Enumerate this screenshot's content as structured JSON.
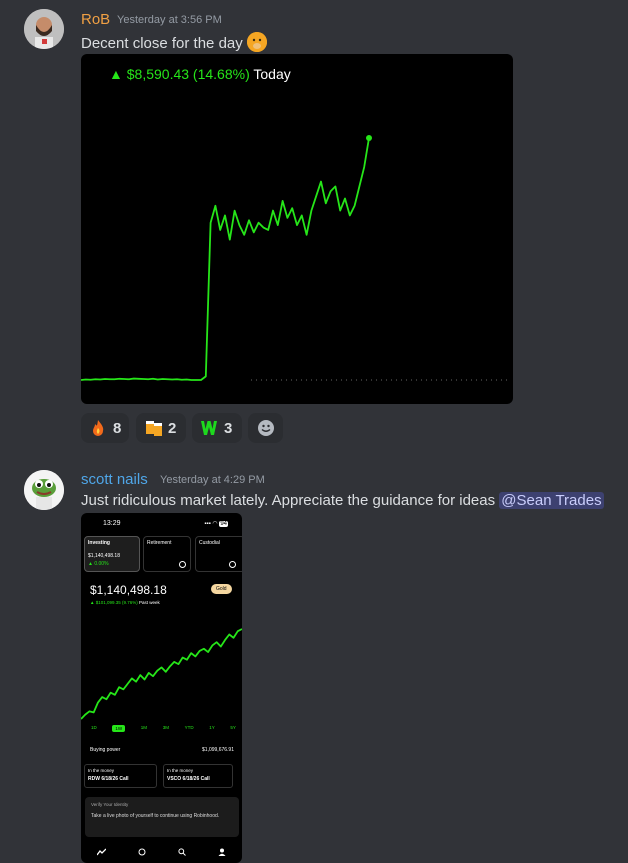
{
  "messages": [
    {
      "username": "RoB",
      "username_color": "#f0a044",
      "timestamp": "Yesterday at 3:56 PM",
      "text": "Decent close for the day",
      "emoji": "face-with-hand-over-mouth",
      "attachment": {
        "gain_text": "▲ $8,590.43 (14.68%)",
        "period": "Today",
        "chart_data": {
          "type": "line",
          "color": "#26e619",
          "series": [
            {
              "values": [
                0.0,
                0.2,
                0.1,
                0.3,
                0.2,
                0.4,
                0.3,
                0.3,
                0.5,
                0.4,
                0.3,
                0.6,
                0.5,
                0.4,
                0.3,
                0.5,
                0.2,
                0.4,
                0.3,
                0.2,
                0.3,
                0.1,
                0.2,
                0.0,
                0.0,
                0.0,
                1.5,
                65.0,
                72.0,
                62.0,
                68.0,
                58.0,
                70.0,
                64.0,
                60.0,
                66.0,
                61.0,
                65.0,
                63.0,
                62.0,
                70.0,
                64.0,
                74.0,
                67.0,
                71.0,
                64.0,
                68.0,
                60.0,
                70.0,
                76.0,
                82.0,
                73.0,
                78.0,
                80.0,
                70.0,
                75.0,
                68.0,
                72.0,
                80.0,
                88.0,
                100.0
              ]
            }
          ]
        }
      },
      "reactions": [
        {
          "icon": "fire-emoji",
          "count": "8"
        },
        {
          "icon": "beer-mugs-emoji",
          "count": "2"
        },
        {
          "icon": "green-w-emoji",
          "count": "3"
        },
        {
          "icon": "add-reaction-icon",
          "count": ""
        }
      ]
    },
    {
      "username": "scott nails",
      "username_color": "#4fa6e8",
      "timestamp": "Yesterday at 4:29 PM",
      "text": "Just ridiculous market lately. Appreciate the guidance for ideas",
      "mention": "@Sean Trades",
      "attachment": {
        "time": "13:29",
        "battery": "94",
        "tabs": [
          {
            "label": "Investing",
            "value": "$1,140,498.18",
            "sub": "▲ 0.00%"
          },
          {
            "label": "Retirement",
            "value": "",
            "sub": ""
          },
          {
            "label": "Custodial",
            "value": "",
            "sub": ""
          }
        ],
        "balance": "$1,140,498.18",
        "badge": "Gold",
        "gain": "▲ $101,099.35 (9.76%)",
        "gain_period": "Past week",
        "ranges": [
          "1D",
          "1W",
          "1M",
          "3M",
          "YTD",
          "1Y",
          "5Y"
        ],
        "selected_range": "1W",
        "buying_power_label": "Buying power",
        "buying_power_value": "$1,099,676.91",
        "positions": [
          {
            "tag": "In the money",
            "name": "RDW 6/18/26 Call"
          },
          {
            "tag": "In the money",
            "name": "VSCO 6/18/26 Call"
          }
        ],
        "verify_title": "Verify Your Identity",
        "verify_text": "Take a live photo of yourself to continue using Robinhood.",
        "chart_data": {
          "type": "line",
          "color": "#26e619",
          "series": [
            {
              "values": [
                18,
                22,
                25,
                24,
                33,
                38,
                36,
                42,
                40,
                47,
                45,
                50,
                55,
                52,
                58,
                54,
                60,
                57,
                62,
                65,
                61,
                66,
                70,
                68,
                74,
                72,
                78,
                75,
                80,
                82,
                79,
                85,
                88,
                84,
                90,
                95,
                92,
                98,
                100
              ]
            }
          ]
        }
      }
    }
  ]
}
